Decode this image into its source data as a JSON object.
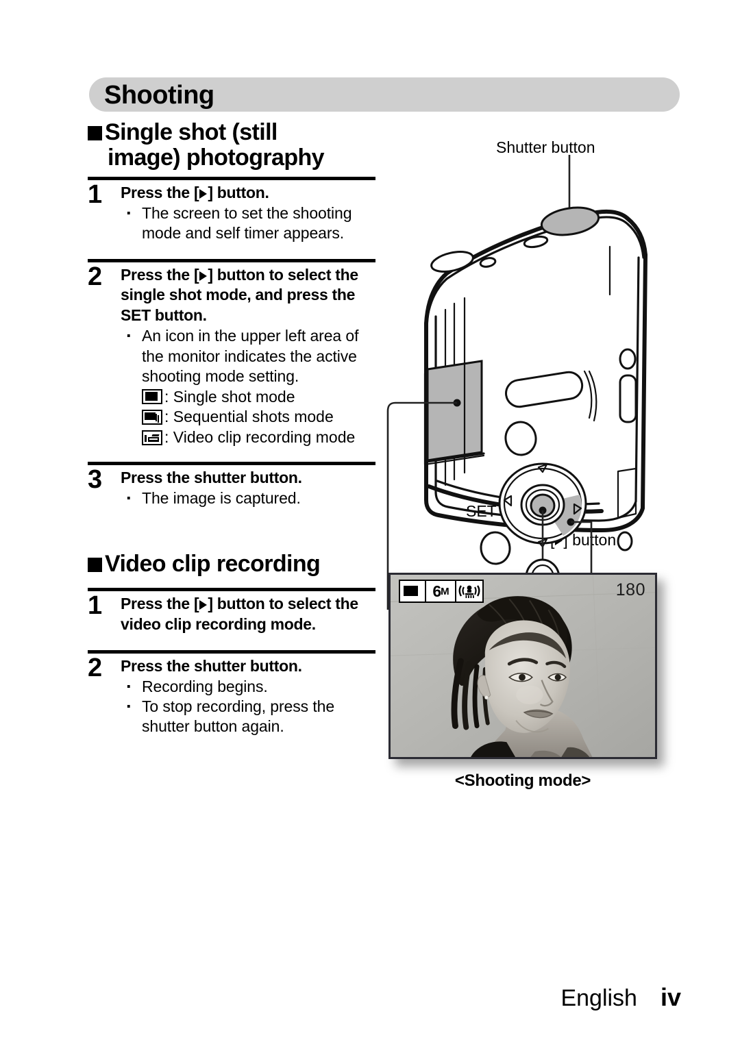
{
  "header": {
    "title": "Shooting"
  },
  "sections": [
    {
      "id": "single-shot",
      "heading_line1": "Single shot (still",
      "heading_line2": "image) photography",
      "steps": [
        {
          "number": "1",
          "title_pre": "Press the [",
          "title_post": "] button.",
          "bullets": [
            "The screen to set the shooting mode and self timer appears."
          ],
          "modes": []
        },
        {
          "number": "2",
          "title_pre": "Press the [",
          "title_post": "] button to select the single shot mode, and press the SET button.",
          "bullets": [
            "An icon in the upper left area of the monitor indicates the active shooting mode setting."
          ],
          "modes": [
            {
              "icon": "single-shot-icon",
              "label": ": Single shot mode"
            },
            {
              "icon": "sequential-shots-icon",
              "label": ": Sequential shots mode"
            },
            {
              "icon": "video-clip-icon",
              "label": ": Video clip recording mode"
            }
          ]
        },
        {
          "number": "3",
          "title_pre": "Press the shutter button.",
          "title_post": "",
          "bullets": [
            "The image is captured."
          ],
          "modes": []
        }
      ]
    },
    {
      "id": "video-clip",
      "heading_line1": "Video clip recording",
      "heading_line2": "",
      "steps": [
        {
          "number": "1",
          "title_pre": "Press the [",
          "title_post": "] button to select the video clip recording mode.",
          "bullets": [],
          "modes": []
        },
        {
          "number": "2",
          "title_pre": "Press the shutter button.",
          "title_post": "",
          "bullets": [
            "Recording begins.",
            "To stop recording, press the shutter button again."
          ],
          "modes": []
        }
      ]
    }
  ],
  "diagram": {
    "shutter_label": "Shutter button",
    "set_label": "SET button",
    "play_label_pre": "[",
    "play_label_post": "] button",
    "caption": "<Shooting mode>"
  },
  "monitor": {
    "mode_icon": "single-shot-icon",
    "resolution_big": "6",
    "resolution_small": "M",
    "shake_icon": "camera-shake-icon",
    "counter": "180"
  },
  "footer": {
    "language": "English",
    "page": "iv"
  },
  "colors": {
    "header_bar": "#cfcfcf",
    "monitor_gray": "#b5b5b5",
    "photo_border": "#2b2b33",
    "ink": "#000000"
  }
}
